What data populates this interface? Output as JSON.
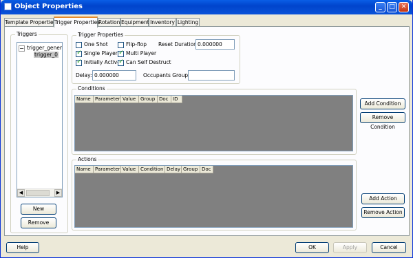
{
  "window": {
    "title": "Object Properties"
  },
  "tabs": [
    "Template Properties",
    "Trigger Properties",
    "Rotation",
    "Equipment",
    "Inventory",
    "Lighting"
  ],
  "active_tab": "Trigger Properties",
  "triggers": {
    "label": "Triggers",
    "tree": {
      "root": "trigger_generic_",
      "child": "trigger_0"
    },
    "new_button": "New",
    "remove_button": "Remove"
  },
  "trigger_properties": {
    "label": "Trigger Properties",
    "one_shot": {
      "label": "One Shot",
      "checked": false
    },
    "flip_flop": {
      "label": "Flip-flop",
      "checked": false
    },
    "single_player": {
      "label": "Single Player",
      "checked": true
    },
    "multi_player": {
      "label": "Multi Player",
      "checked": true
    },
    "initially_active": {
      "label": "Initially Active",
      "checked": true
    },
    "can_self_destruct": {
      "label": "Can Self Destruct",
      "checked": true
    },
    "reset_duration_label": "Reset Duration:",
    "reset_duration_value": "0.000000",
    "delay_label": "Delay:",
    "delay_value": "0.000000",
    "occupants_group_label": "Occupants Group:",
    "occupants_group_value": ""
  },
  "conditions": {
    "label": "Conditions",
    "columns": [
      "Name",
      "Parameter",
      "Value",
      "Group",
      "Doc",
      "ID"
    ],
    "add_button": "Add Condition",
    "remove_button": "Remove Condition"
  },
  "actions": {
    "label": "Actions",
    "columns": [
      "Name",
      "Parameter",
      "Value",
      "Condition",
      "Delay",
      "Group",
      "Doc"
    ],
    "add_button": "Add Action",
    "remove_button": "Remove Action"
  },
  "footer": {
    "help": "Help",
    "ok": "OK",
    "apply": "Apply",
    "cancel": "Cancel"
  },
  "colors": {
    "titlebar": "#0a53d9",
    "listview_bg": "#808080",
    "tab_highlight": "#e68b2c",
    "check": "#21a121"
  }
}
